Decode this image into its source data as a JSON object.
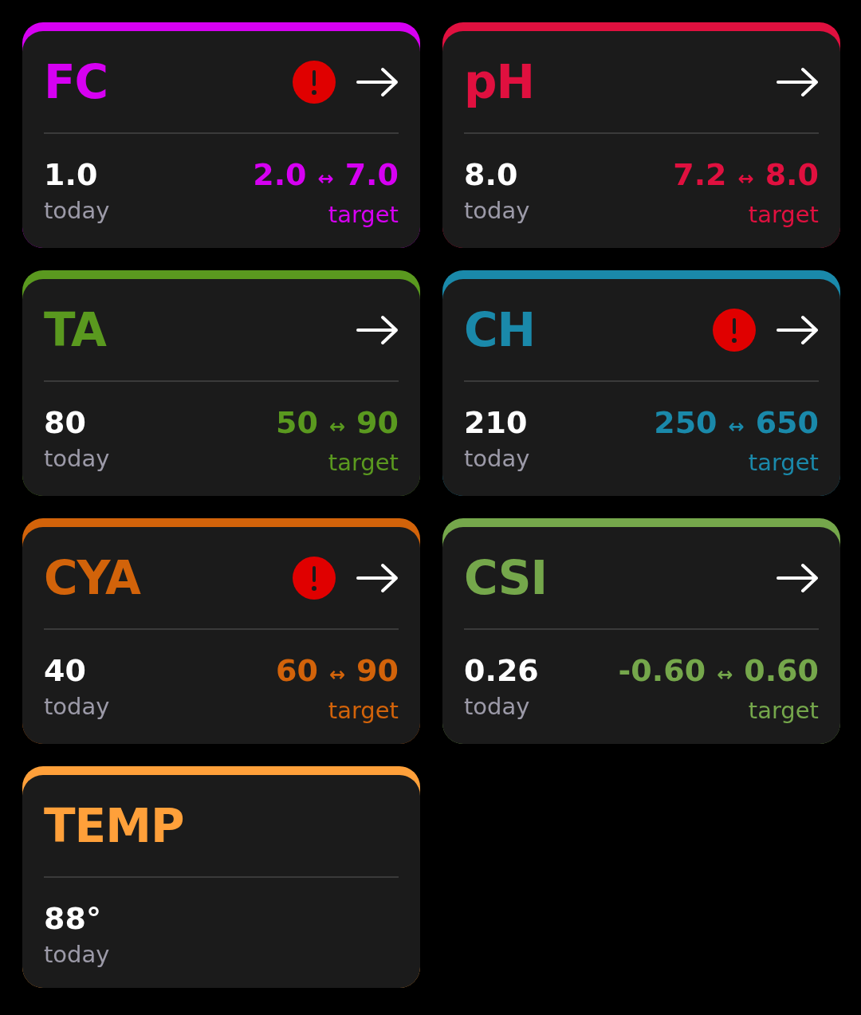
{
  "cards": [
    {
      "title": "FC",
      "color": "#d600f2",
      "alert": true,
      "arrow": true,
      "today": "1.0",
      "today_label": "today",
      "target": {
        "low": "2.0",
        "separator": "↔",
        "high": "7.0",
        "label": "target"
      }
    },
    {
      "title": "pH",
      "color": "#e0103f",
      "alert": false,
      "arrow": true,
      "today": "8.0",
      "today_label": "today",
      "target": {
        "low": "7.2",
        "separator": "↔",
        "high": "8.0",
        "label": "target"
      }
    },
    {
      "title": "TA",
      "color": "#5a991f",
      "alert": false,
      "arrow": true,
      "today": "80",
      "today_label": "today",
      "target": {
        "low": "50",
        "separator": "↔",
        "high": "90",
        "label": "target"
      }
    },
    {
      "title": "CH",
      "color": "#1a89aa",
      "alert": true,
      "arrow": true,
      "today": "210",
      "today_label": "today",
      "target": {
        "low": "250",
        "separator": "↔",
        "high": "650",
        "label": "target"
      }
    },
    {
      "title": "CYA",
      "color": "#d2630a",
      "alert": true,
      "arrow": true,
      "today": "40",
      "today_label": "today",
      "target": {
        "low": "60",
        "separator": "↔",
        "high": "90",
        "label": "target"
      }
    },
    {
      "title": "CSI",
      "color": "#75a74b",
      "alert": false,
      "arrow": true,
      "today": "0.26",
      "today_label": "today",
      "target": {
        "low": "-0.60",
        "separator": "↔",
        "high": "0.60",
        "label": "target"
      }
    },
    {
      "title": "TEMP",
      "color": "#ffa03a",
      "alert": false,
      "arrow": false,
      "today": "88°",
      "today_label": "today"
    }
  ]
}
